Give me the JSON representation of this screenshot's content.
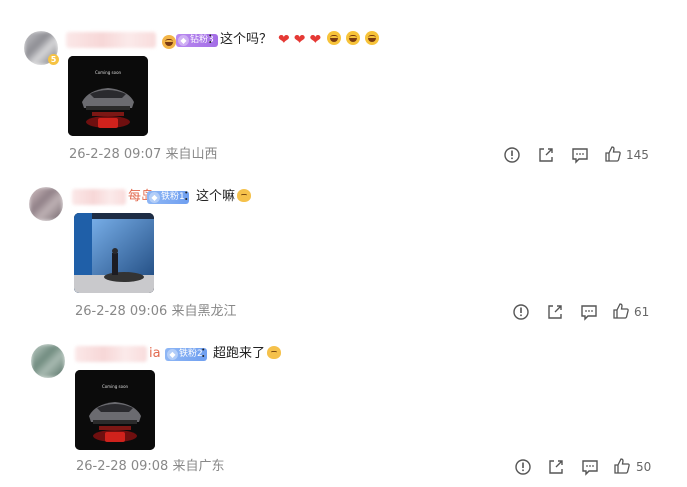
{
  "comments": [
    {
      "fan_badge": "钻粉3",
      "text": "：这个吗？",
      "hearts": [
        "❤",
        "❤",
        "❤"
      ],
      "meta": "26-2-28 09:07 来自山西",
      "likes": "145",
      "thumb_caption": "Coming soon"
    },
    {
      "name_tail": "每岛",
      "fan_badge": "铁粉1",
      "text": "：这个嘛",
      "meta": "26-2-28 09:06 来自黑龙江",
      "likes": "61"
    },
    {
      "name_tail": "ia",
      "fan_badge": "铁粉2",
      "text": "：超跑来了",
      "meta": "26-2-28 09:08 来自广东",
      "likes": "50",
      "thumb_caption": "Coming soon"
    }
  ],
  "colors": {
    "badge_diamond": "#a36de6",
    "badge_iron": "#6f9ff0",
    "heart": "#e53935",
    "name_tail": "#e26a4f",
    "meta_text": "#888888"
  },
  "icons": [
    "report-icon",
    "share-icon",
    "comment-icon",
    "like-icon"
  ]
}
